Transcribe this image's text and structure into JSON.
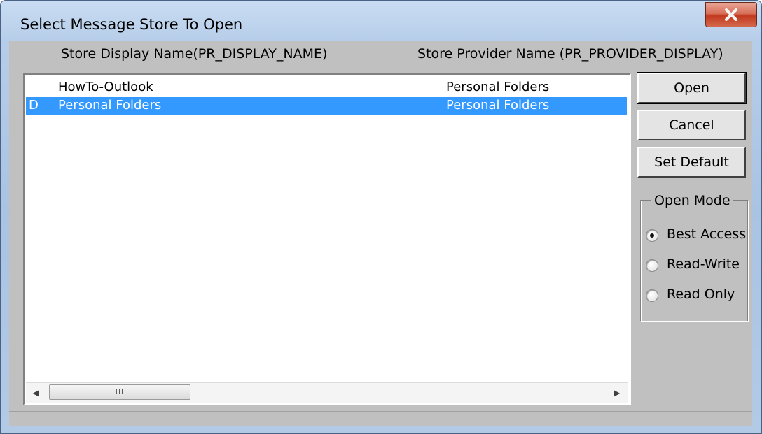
{
  "window": {
    "title": "Select Message Store To Open"
  },
  "columns": {
    "display_name": "Store Display Name(PR_DISPLAY_NAME)",
    "provider_name": "Store Provider Name (PR_PROVIDER_DISPLAY)"
  },
  "stores": [
    {
      "flag": "",
      "display_name": "HowTo-Outlook",
      "provider": "Personal Folders",
      "selected": false
    },
    {
      "flag": "D",
      "display_name": "Personal Folders",
      "provider": "Personal Folders",
      "selected": true
    }
  ],
  "scrollbar": {
    "thumb_grip": "III"
  },
  "buttons": {
    "open": "Open",
    "cancel": "Cancel",
    "set_default": "Set Default"
  },
  "open_mode": {
    "label": "Open Mode",
    "options": [
      "Best Access",
      "Read-Write",
      "Read Only"
    ],
    "selected": "Best Access"
  },
  "colors": {
    "selection": "#3399ff",
    "close_button": "#c7492f"
  },
  "icons": {
    "close": "close-icon",
    "scroll_left": "arrow-left-icon",
    "scroll_right": "arrow-right-icon"
  }
}
